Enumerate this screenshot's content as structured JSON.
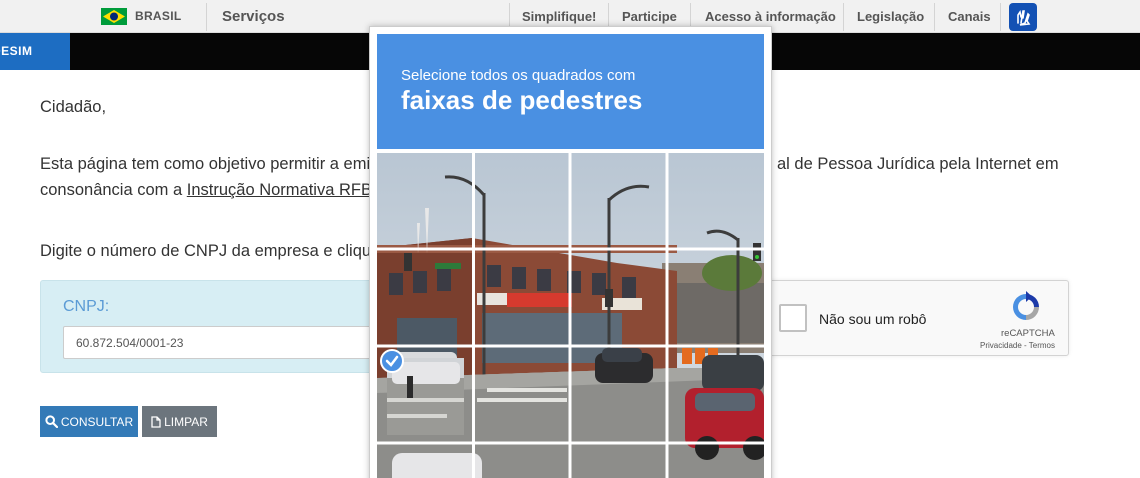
{
  "govbar": {
    "country": "BRASIL",
    "services": "Serviços",
    "links": [
      "Simplifique!",
      "Participe",
      "Acesso à informação",
      "Legislação",
      "Canais"
    ],
    "flag_colors": {
      "green": "#009c3b",
      "yellow": "#ffdf00",
      "blue": "#002776"
    }
  },
  "header": {
    "brand_fragment": "DESIM"
  },
  "content": {
    "greeting": "Cidadão,",
    "para_start": "Esta página tem como objetivo permitir a emis",
    "para_end": "al de Pessoa Jurídica pela Internet em",
    "para_line2_prefix": "consonância com a ",
    "para_line2_link": "Instrução Normativa RFB n",
    "instruction": "Digite o número de CNPJ da empresa e clique e",
    "cnpj_label": "CNPJ:",
    "cnpj_value": "60.872.504/0001-23",
    "consult_label": "CONSULTAR",
    "clear_label": "LIMPAR"
  },
  "recaptcha": {
    "checkbox_label": "Não sou um robô",
    "brand": "reCAPTCHA",
    "privacy": "Privacidade",
    "terms": "Termos",
    "separator": " - "
  },
  "challenge": {
    "instruction_small": "Selecione todos os quadrados com",
    "instruction_big": "faixas de pedestres",
    "grid": [
      4,
      4
    ],
    "selected_tiles": [
      [
        2,
        0
      ]
    ],
    "accent": "#4a90e2"
  }
}
